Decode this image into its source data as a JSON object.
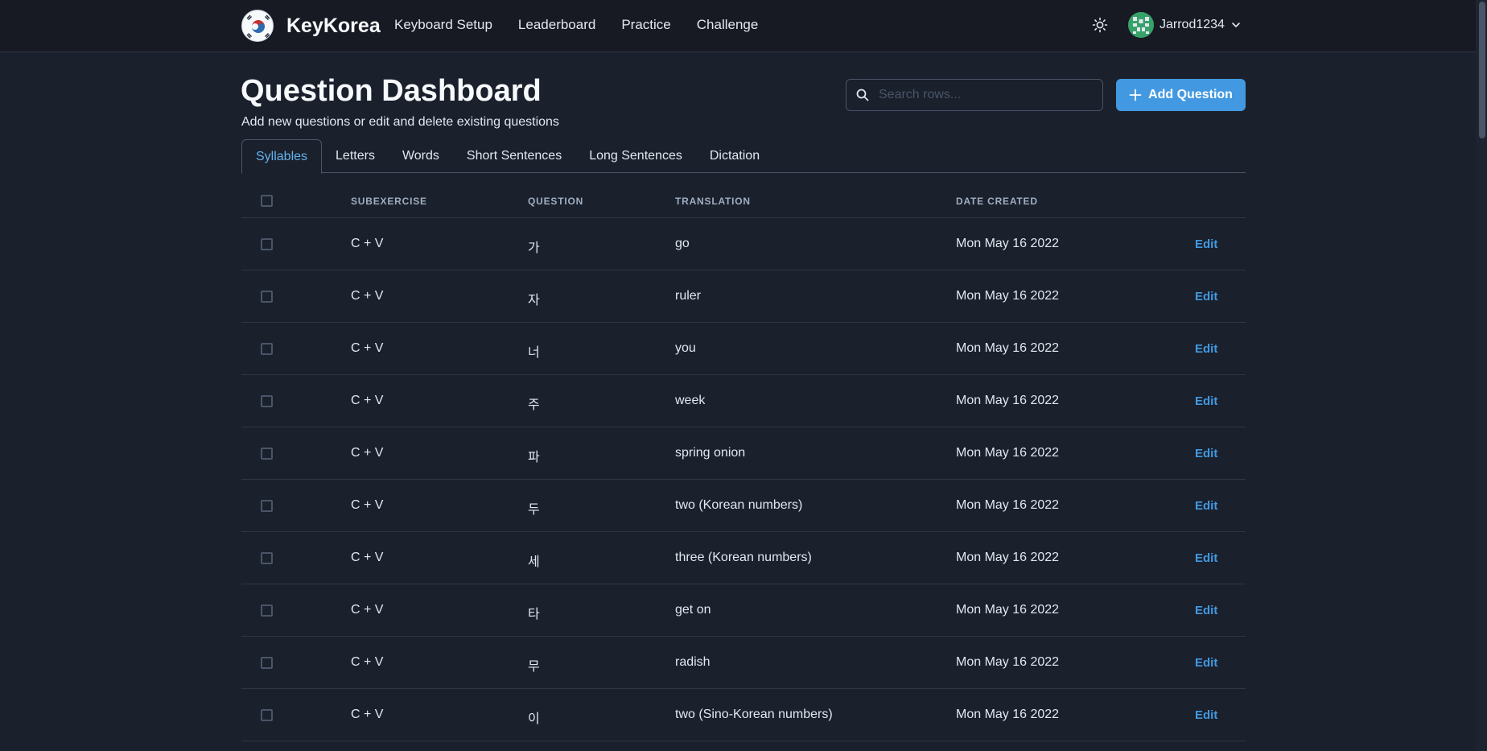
{
  "app": {
    "brand": "KeyKorea",
    "nav": [
      "Keyboard Setup",
      "Leaderboard",
      "Practice",
      "Challenge"
    ],
    "user": {
      "name": "Jarrod1234"
    },
    "icons": {
      "theme": "sun-icon",
      "user_menu": "chevron-down-icon",
      "avatar": "identicon-avatar"
    }
  },
  "page": {
    "title": "Question Dashboard",
    "subtitle": "Add new questions or edit and delete existing questions",
    "search_placeholder": "Search rows...",
    "add_button": "Add Question"
  },
  "tabs": [
    "Syllables",
    "Letters",
    "Words",
    "Short Sentences",
    "Long Sentences",
    "Dictation"
  ],
  "active_tab": "Syllables",
  "table": {
    "columns": [
      "SUBEXERCISE",
      "QUESTION",
      "TRANSLATION",
      "DATE CREATED"
    ],
    "edit_label": "Edit",
    "rows": [
      {
        "subexercise": "C + V",
        "question": "가",
        "translation": "go",
        "date": "Mon May 16 2022"
      },
      {
        "subexercise": "C + V",
        "question": "자",
        "translation": "ruler",
        "date": "Mon May 16 2022"
      },
      {
        "subexercise": "C + V",
        "question": "너",
        "translation": "you",
        "date": "Mon May 16 2022"
      },
      {
        "subexercise": "C + V",
        "question": "주",
        "translation": "week",
        "date": "Mon May 16 2022"
      },
      {
        "subexercise": "C + V",
        "question": "파",
        "translation": "spring onion",
        "date": "Mon May 16 2022"
      },
      {
        "subexercise": "C + V",
        "question": "두",
        "translation": "two (Korean numbers)",
        "date": "Mon May 16 2022"
      },
      {
        "subexercise": "C + V",
        "question": "세",
        "translation": "three (Korean numbers)",
        "date": "Mon May 16 2022"
      },
      {
        "subexercise": "C + V",
        "question": "타",
        "translation": "get on",
        "date": "Mon May 16 2022"
      },
      {
        "subexercise": "C + V",
        "question": "무",
        "translation": "radish",
        "date": "Mon May 16 2022"
      },
      {
        "subexercise": "C + V",
        "question": "이",
        "translation": "two (Sino-Korean numbers)",
        "date": "Mon May 16 2022"
      }
    ]
  },
  "colors": {
    "background": "#1a202c",
    "accent": "#4299e1",
    "active_tab": "#63b3ed"
  }
}
